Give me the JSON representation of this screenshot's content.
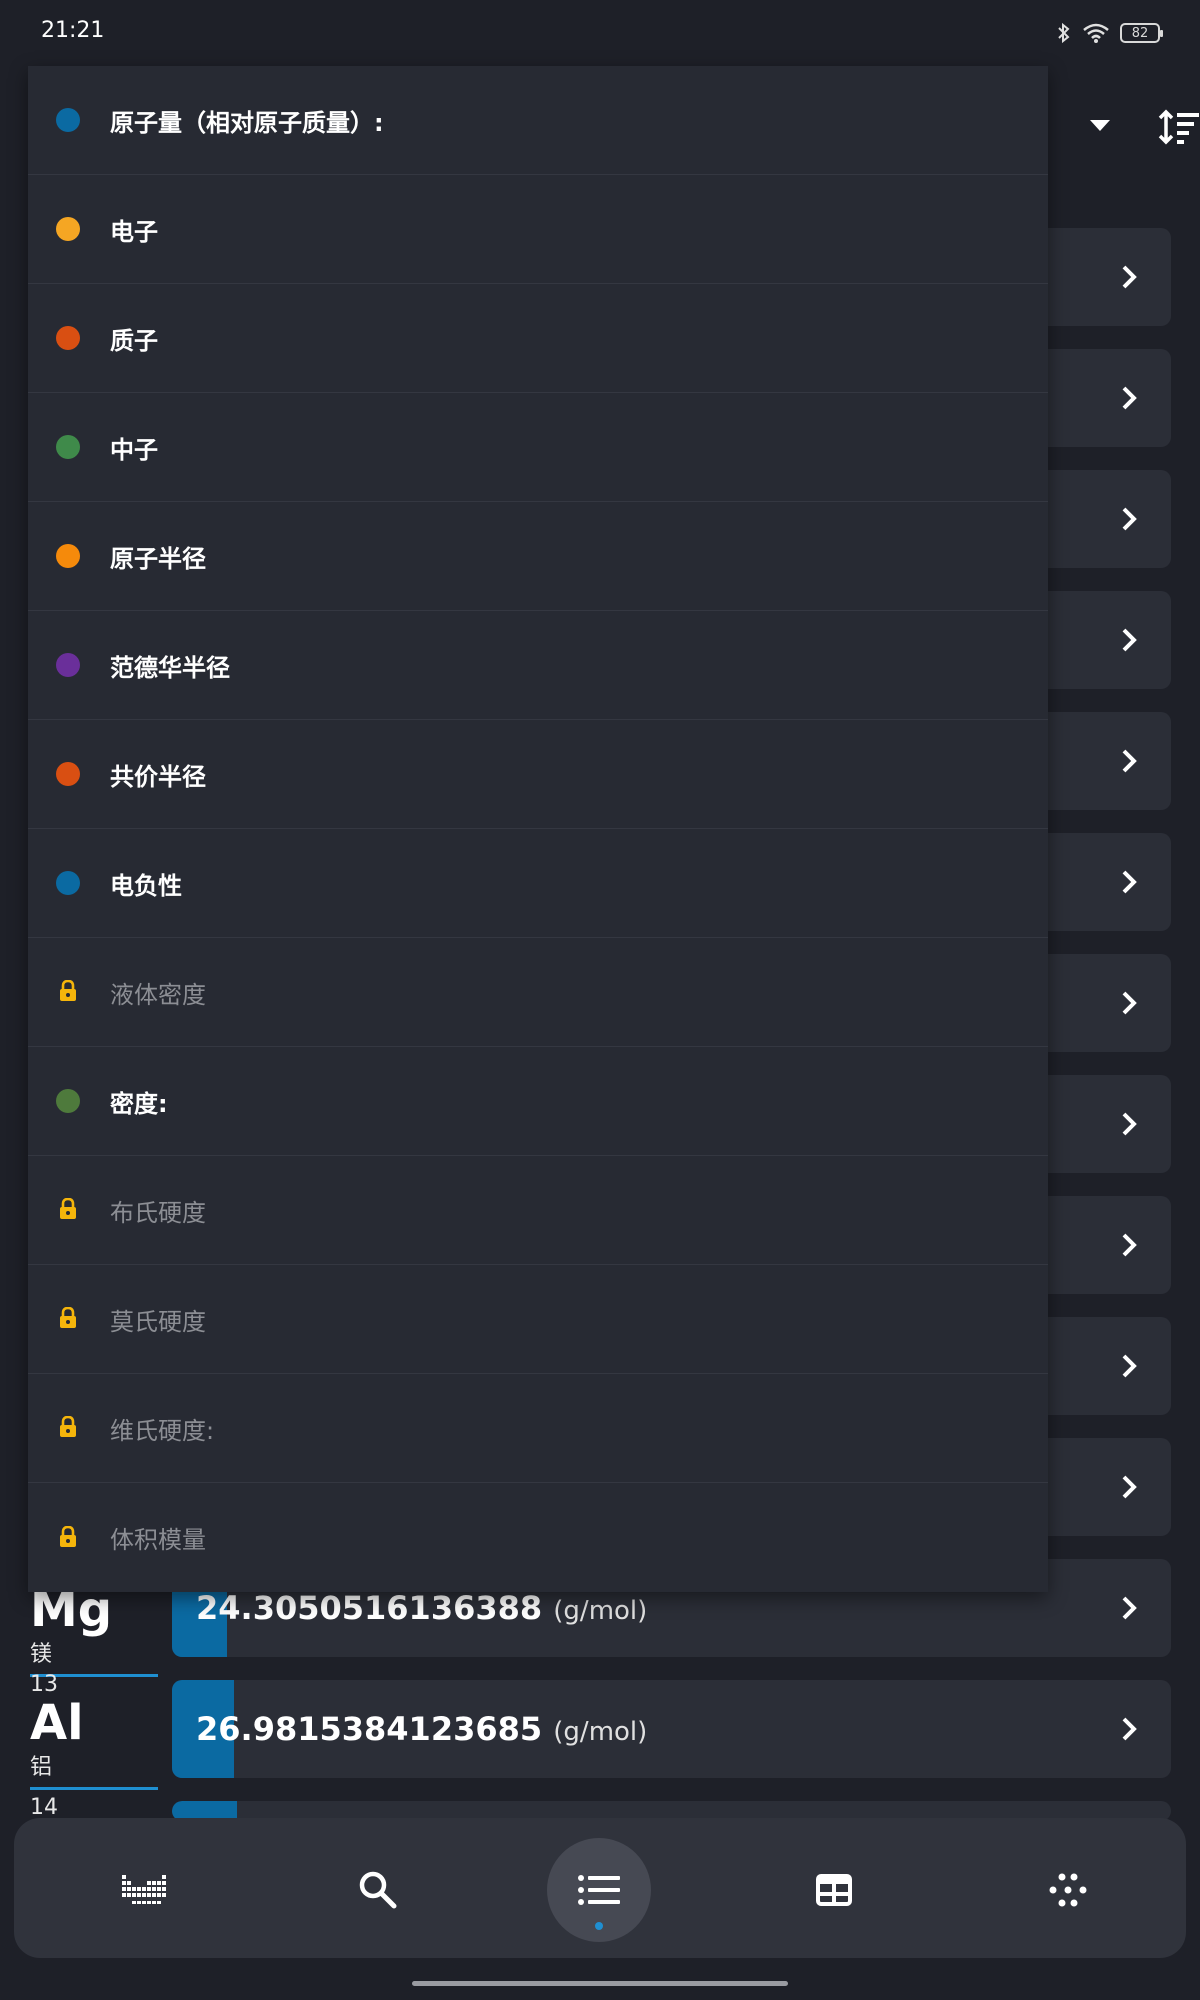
{
  "status_bar": {
    "time": "21:21",
    "battery": "82",
    "icons": [
      "bluetooth-icon",
      "wifi-icon",
      "battery-icon"
    ]
  },
  "header": {
    "dropdown_icon": "caret-down-icon",
    "sort_icon": "sort-icon"
  },
  "sort_menu": {
    "items": [
      {
        "label": "原子量（相对原子质量）:",
        "color": "#0b6aa2",
        "locked": false
      },
      {
        "label": "电子",
        "color": "#f5a623",
        "locked": false
      },
      {
        "label": "质子",
        "color": "#d94f12",
        "locked": false
      },
      {
        "label": "中子",
        "color": "#3f8a4a",
        "locked": false
      },
      {
        "label": "原子半径",
        "color": "#f58a0b",
        "locked": false
      },
      {
        "label": "范德华半径",
        "color": "#6a2f9a",
        "locked": false
      },
      {
        "label": "共价半径",
        "color": "#d94f12",
        "locked": false
      },
      {
        "label": "电负性",
        "color": "#0b6aa2",
        "locked": false
      },
      {
        "label": "液体密度",
        "color": "#f5b50b",
        "locked": true
      },
      {
        "label": "密度:",
        "color": "#4e7a3c",
        "locked": false
      },
      {
        "label": "布氏硬度",
        "color": "#f5b50b",
        "locked": true
      },
      {
        "label": "莫氏硬度",
        "color": "#f5b50b",
        "locked": true
      },
      {
        "label": "维氏硬度:",
        "color": "#f5b50b",
        "locked": true
      },
      {
        "label": "体积模量",
        "color": "#f5b50b",
        "locked": true
      }
    ]
  },
  "element_list": {
    "rows": [
      {
        "number": "",
        "symbol": "Mg",
        "name": "镁",
        "value": "24.3050516136388",
        "unit": "(g/mol)",
        "fill_fraction": 0.055
      },
      {
        "number": "13",
        "symbol": "Al",
        "name": "铝",
        "value": "26.9815384123685",
        "unit": "(g/mol)",
        "fill_fraction": 0.062
      },
      {
        "number": "14",
        "symbol": "",
        "name": "",
        "value": "",
        "unit": "",
        "fill_fraction": 0.065
      }
    ]
  },
  "bottom_nav": {
    "items": [
      {
        "icon": "periodic-chart-icon",
        "active": false
      },
      {
        "icon": "search-icon",
        "active": false
      },
      {
        "icon": "list-icon",
        "active": true
      },
      {
        "icon": "table-icon",
        "active": false
      },
      {
        "icon": "dots-grid-icon",
        "active": false
      }
    ]
  }
}
